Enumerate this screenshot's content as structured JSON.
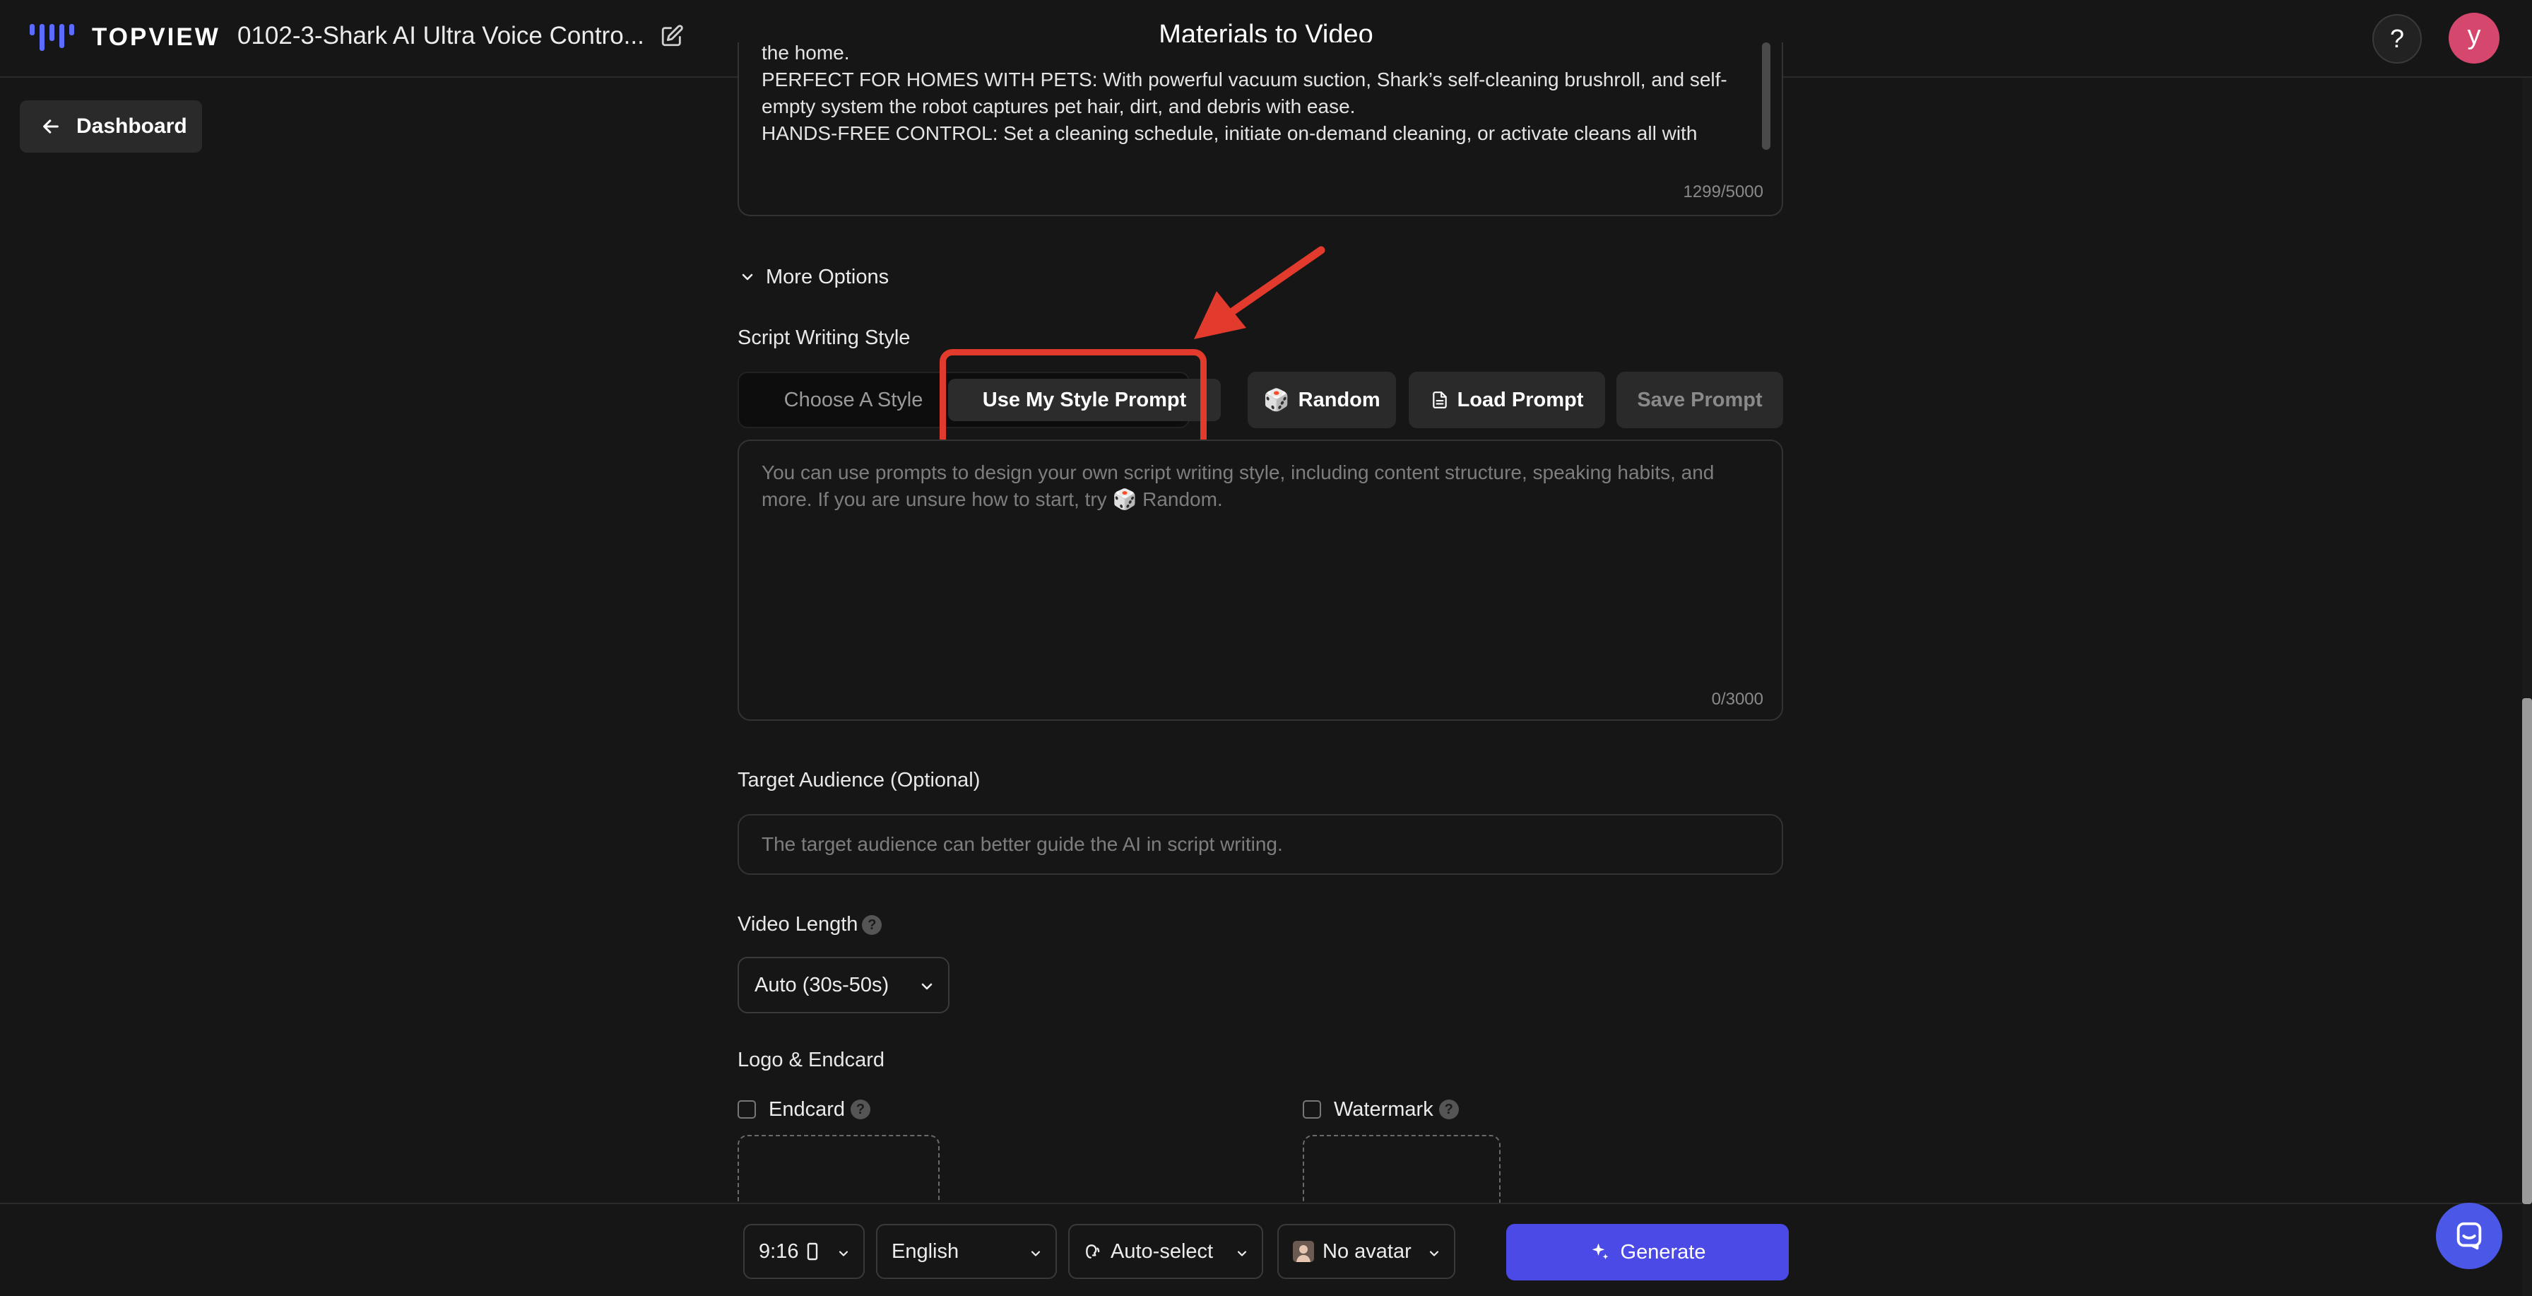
{
  "header": {
    "logo_text": "TOPVIEW",
    "project_title": "0102-3-Shark AI Ultra Voice Contro...",
    "page_title": "Materials to Video",
    "help_label": "?",
    "avatar_letter": "y"
  },
  "nav": {
    "dashboard_label": "Dashboard"
  },
  "description": {
    "text": "the home.\nPERFECT FOR HOMES WITH PETS: With powerful vacuum suction, Shark’s self-cleaning brushroll, and self-empty system the robot captures pet hair, dirt, and debris with ease.\nHANDS-FREE CONTROL: Set a cleaning schedule, initiate on-demand cleaning, or activate cleans all with",
    "counter": "1299/5000"
  },
  "more_options_label": "More Options",
  "script_style": {
    "label": "Script Writing Style",
    "tabs": [
      "Choose A Style",
      "Use My Style Prompt"
    ],
    "random_label": "Random",
    "load_prompt_label": "Load Prompt",
    "save_prompt_label": "Save Prompt",
    "prompt_placeholder_1": "You can use prompts to design your own script writing style, including content structure, speaking habits, and more. If you are unsure how to start, try",
    "prompt_placeholder_2": "Random.",
    "prompt_counter": "0/3000"
  },
  "target_audience": {
    "label": "Target Audience (Optional)",
    "placeholder": "The target audience can better guide the AI in script writing."
  },
  "video_length": {
    "label": "Video Length",
    "value": "Auto (30s-50s)"
  },
  "logo_endcard": {
    "label": "Logo & Endcard",
    "endcard_label": "Endcard",
    "watermark_label": "Watermark"
  },
  "bottom_bar": {
    "ratio": "9:16",
    "language": "English",
    "voice": "Auto-select",
    "avatar": "No avatar",
    "generate_label": "Generate"
  },
  "colors": {
    "accent": "#4b4ae6",
    "highlight": "#e23b2e",
    "avatar": "#d6476e"
  }
}
